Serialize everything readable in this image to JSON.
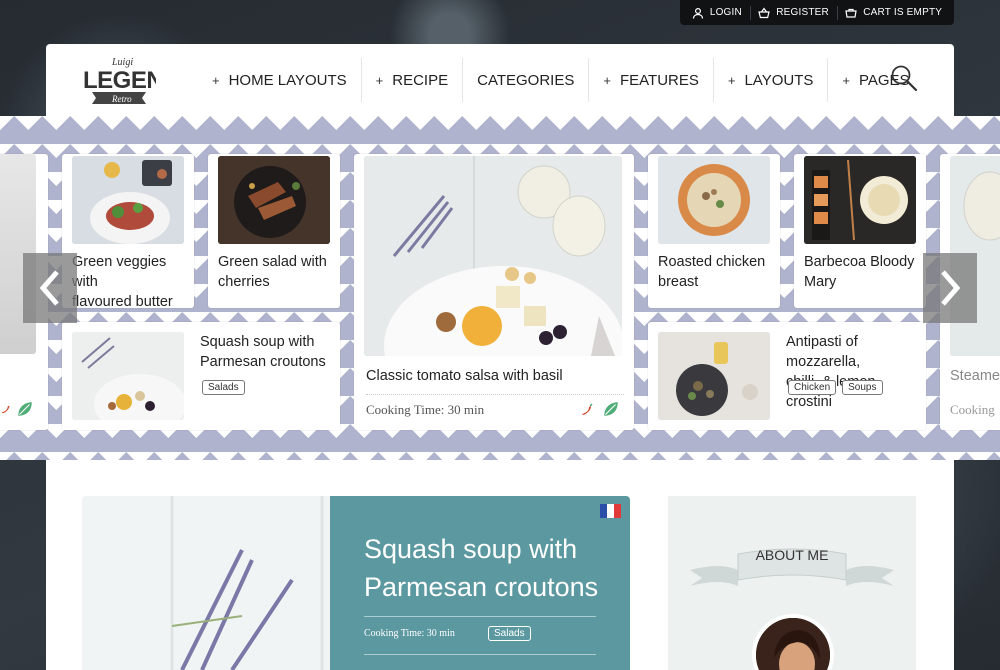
{
  "topbar": {
    "login": "LOGIN",
    "register": "REGISTER",
    "cart": "CART IS EMPTY"
  },
  "logo": {
    "script": "Luigi",
    "main": "LEGEND",
    "ribbon": "Retro"
  },
  "nav": [
    {
      "label": "HOME LAYOUTS",
      "plus": "+"
    },
    {
      "label": "RECIPE",
      "plus": "+"
    },
    {
      "label": "CATEGORIES",
      "plus": ""
    },
    {
      "label": "FEATURES",
      "plus": "+"
    },
    {
      "label": "LAYOUTS",
      "plus": "+"
    },
    {
      "label": "PAGES",
      "plus": "+"
    }
  ],
  "cards": {
    "c1": {
      "title_line1": "Green veggies with",
      "title_line2": "flavoured butter"
    },
    "c2": {
      "title_line1": "Green salad with",
      "title_line2": "cherries"
    },
    "c3": {
      "title_line1": "Squash soup with",
      "title_line2": "Parmesan croutons",
      "tags": [
        "Salads"
      ]
    },
    "center": {
      "title": "Classic tomato salsa with basil",
      "cooking": "Cooking Time: 30 min"
    },
    "c4": {
      "title_line1": "Roasted chicken",
      "title_line2": "breast"
    },
    "c5": {
      "title_line1": "Barbecoa Bloody",
      "title_line2": "Mary"
    },
    "c6": {
      "title_line1": "Antipasti of mozzarella,",
      "title_line2": "chilli, & lemon crostini",
      "tags": [
        "Chicken",
        "Soups"
      ]
    },
    "edge_right": {
      "title": "Steamed",
      "cooking": "Cooking"
    }
  },
  "feature": {
    "title_line1": "Squash soup with",
    "title_line2": "Parmesan croutons",
    "cooking": "Cooking Time: 30 min",
    "tag": "Salads"
  },
  "about": {
    "title": "ABOUT ME"
  },
  "colors": {
    "band": "#b0b3cd",
    "feature_panel": "#5b98a0",
    "chili": "#d9432c",
    "leaf": "#4fae78"
  },
  "icons": [
    "user-icon",
    "basket-icon",
    "cart-icon",
    "search-icon",
    "chevron-left-icon",
    "chevron-right-icon",
    "chili-icon",
    "leaf-icon",
    "french-flag-icon"
  ]
}
